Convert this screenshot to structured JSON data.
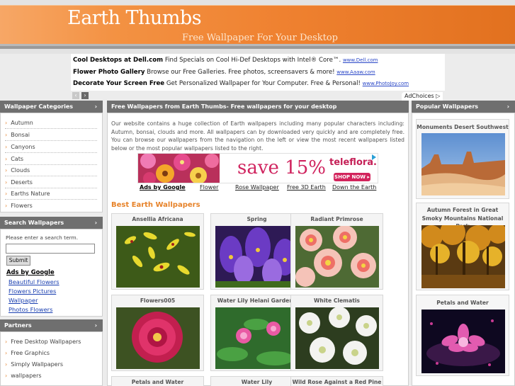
{
  "header": {
    "title": "Earth Thumbs",
    "tagline": "Free Wallpaper For Your Desktop"
  },
  "top_ads": [
    {
      "title": "Cool Desktops at Dell.com",
      "text": " Find Specials on Cool Hi-Def Desktops with Intel® Core™.",
      "url": "www.Dell.com"
    },
    {
      "title": "Flower Photo Gallery",
      "text": " Browse our Free Galleries. Free photos, screensavers & more!",
      "url": "www.Aaaw.com"
    },
    {
      "title": "Decorate Your Screen Free",
      "text": " Get Personalized Wallpaper for Your Computer. Free & Personal!",
      "url": "www.PhotoJoy.com"
    }
  ],
  "ad_nav": {
    "prev": "‹",
    "next": "›"
  },
  "adchoices": "AdChoices ▷",
  "left": {
    "categories_title": "Wallpaper Categories",
    "chevron": "›",
    "categories": [
      "Autumn",
      "Bonsai",
      "Canyons",
      "Cats",
      "Clouds",
      "Deserts",
      "Earths Nature",
      "Flowers"
    ],
    "bullet": "›",
    "search_title": "Search Wallpapers",
    "search_label": "Please enter a search term.",
    "search_value": "",
    "submit_label": "Submit",
    "ads_head": "Ads by Google",
    "ad_links": [
      "Beautiful Flowers",
      "Flowers Pictures",
      "Wallpaper",
      "Photos Flowers"
    ],
    "partners_title": "Partners",
    "partners": [
      "Free Desktop Wallpapers",
      "Free Graphics",
      "Simply Wallpapers",
      "wallpapers"
    ]
  },
  "center": {
    "title": "Free Wallpapers from Earth Thumbs- Free wallpapers for your desktop",
    "intro": "Our website contains a huge collection of Earth wallpapers including many popular characters including: Autumn, bonsai, clouds and more. All wallpapers can by downloaded very quickly and are completely free. You can browse our wallpapers from the navigation on the left or view the most recent wallpapers listed below or the most popular wallpapers listed to the right.",
    "banner_ad": {
      "headline": "save 15%",
      "brand": "teleflora.",
      "cta": "SHOP NOW ▸"
    },
    "ad_links_head": "Ads by Google",
    "ad_links": [
      "Flower",
      "Rose Wallpaper",
      "Free 3D Earth",
      "Down the Earth"
    ],
    "best_title": "Best Earth Wallpapers",
    "thumbs": [
      "Ansellia Africana",
      "Spring",
      "Radiant Primrose",
      "Flowers005",
      "Water Lily Helani Gardens",
      "White Clematis",
      "Petals and Water",
      "Water Lily",
      "Wild Rose Against a Red Pine"
    ]
  },
  "right": {
    "popular_title": "Popular Wallpapers",
    "chevron": "›",
    "items": [
      "Monuments Desert Southwest",
      "Autumn Forest in Great Smoky Mountains National Park",
      "Petals and Water"
    ]
  }
}
